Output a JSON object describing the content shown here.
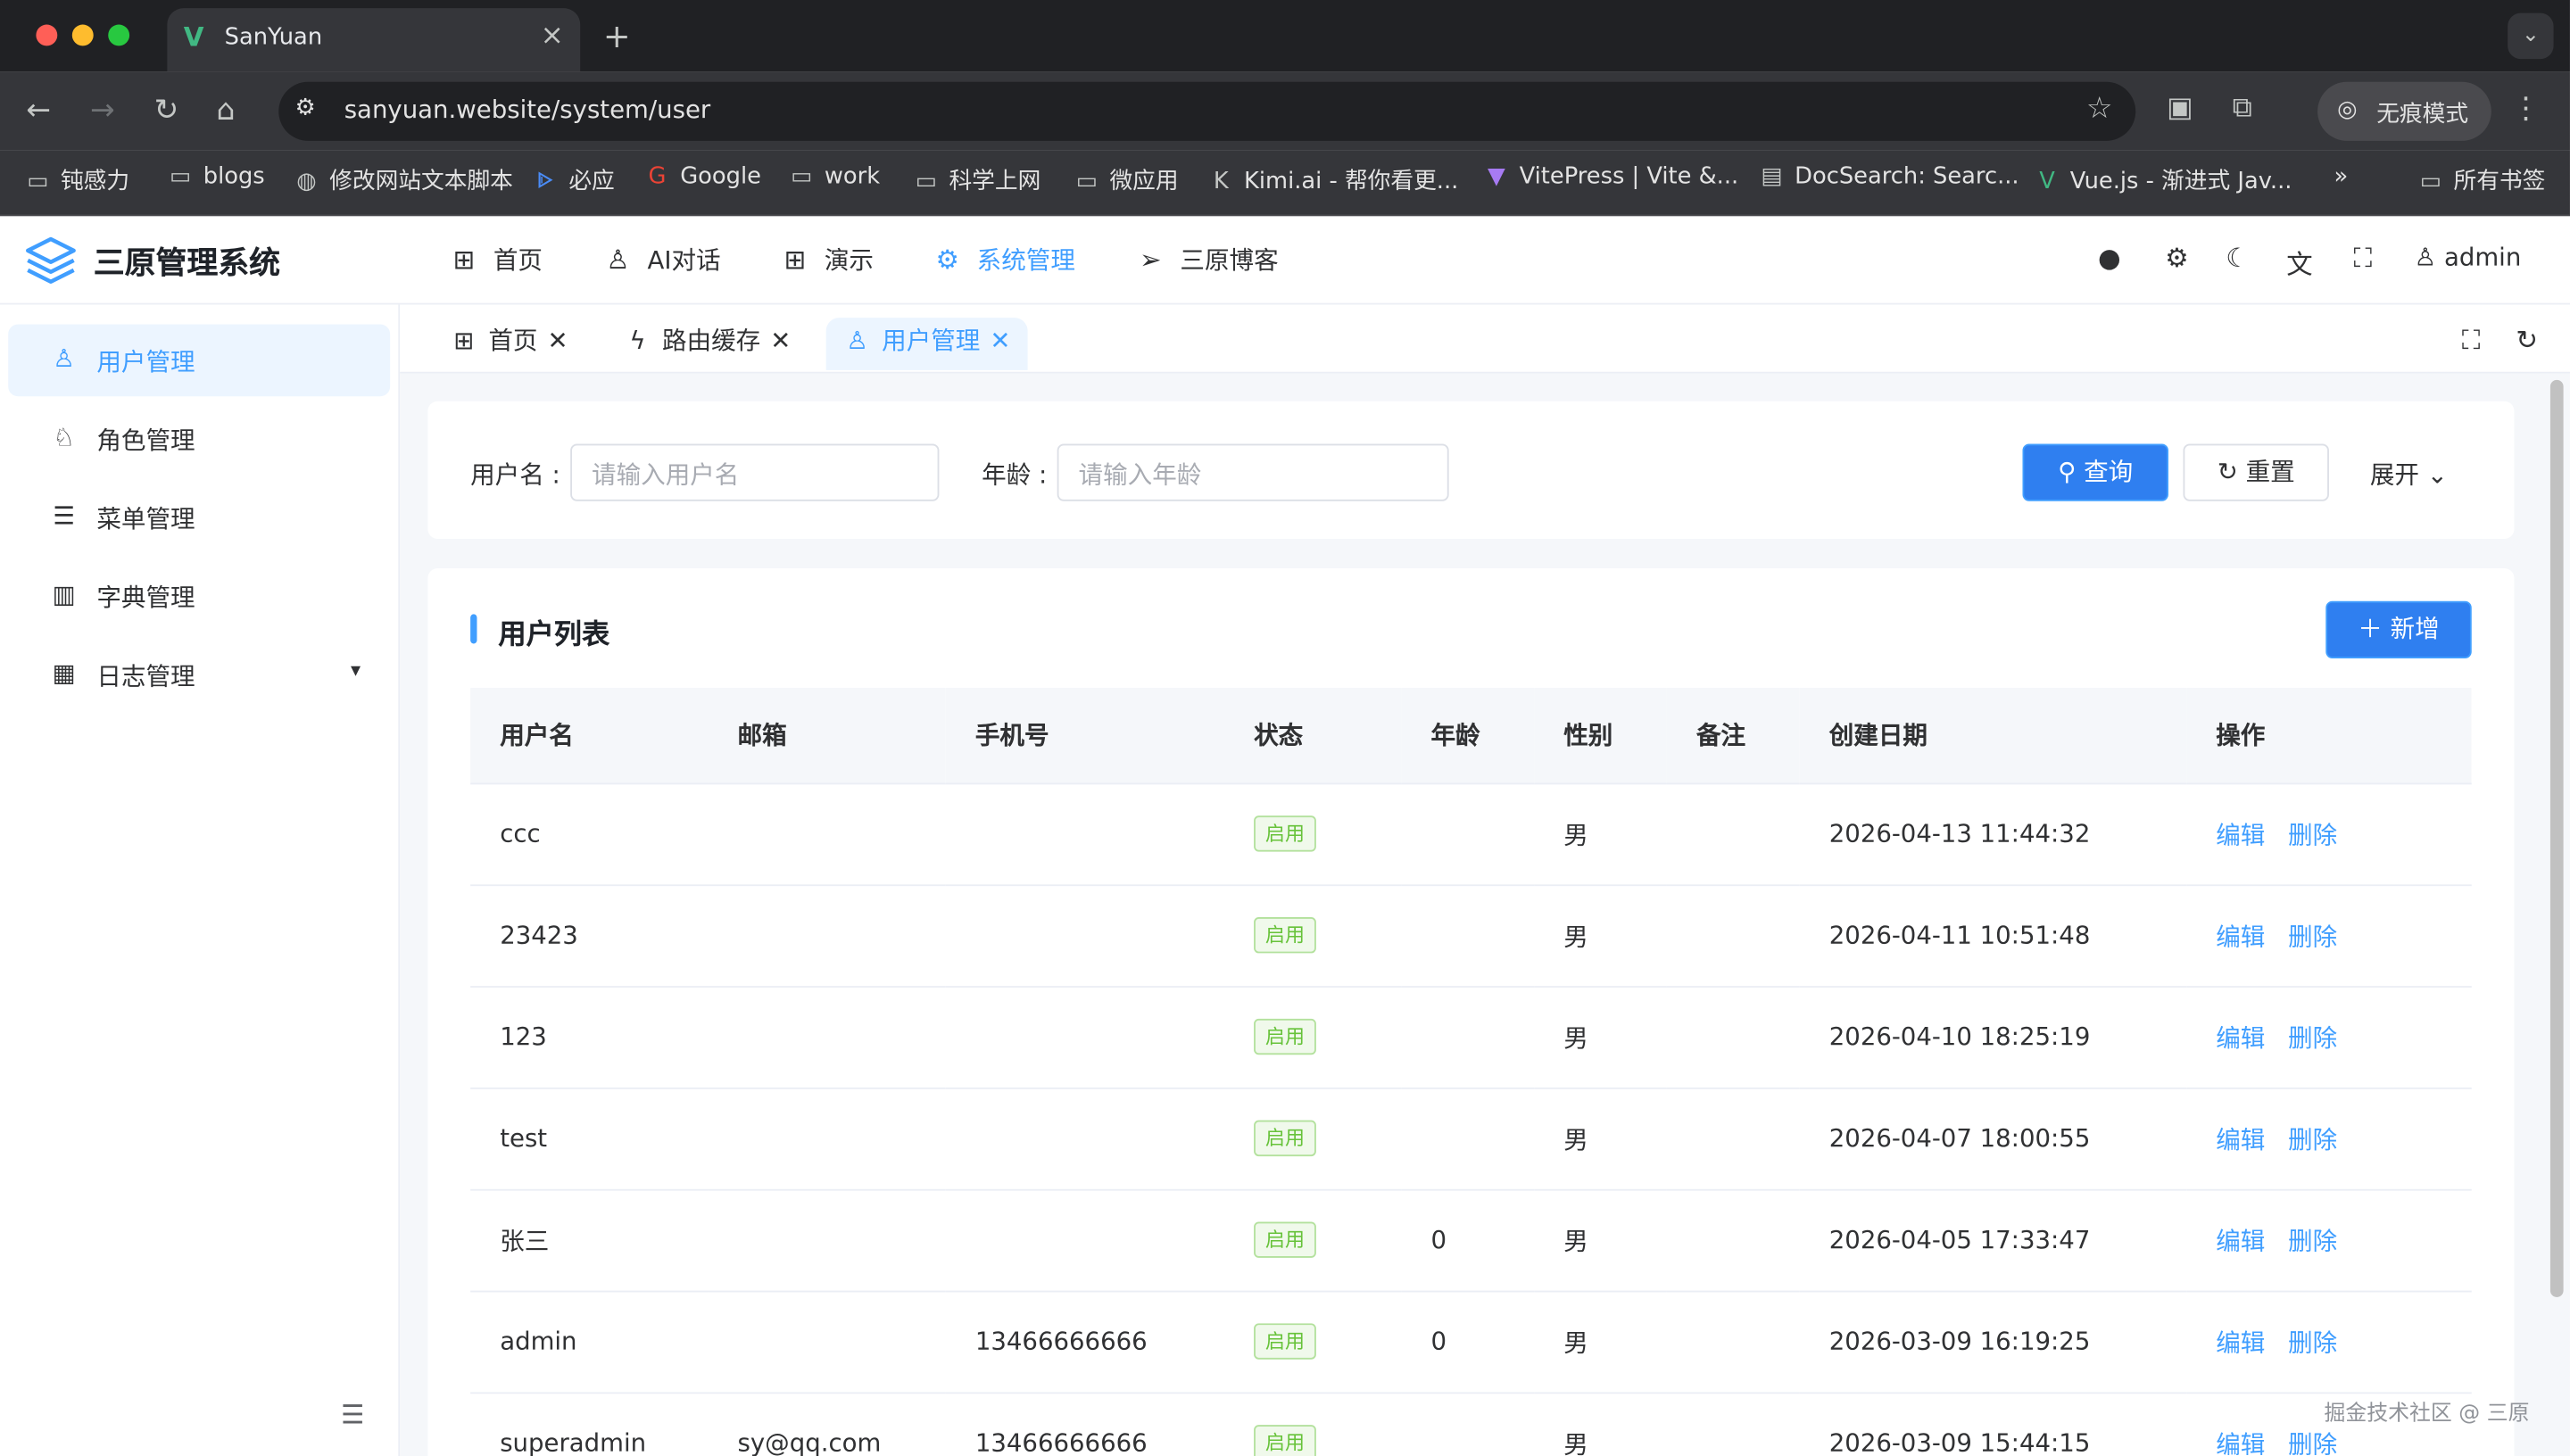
{
  "browser": {
    "tab_title": "SanYuan",
    "tab_favicon": "V",
    "url": "sanyuan.website/system/user",
    "incognito_label": "无痕模式",
    "bookmarks": [
      "钝感力",
      "blogs",
      "修改网站文本脚本",
      "必应",
      "Google",
      "work",
      "科学上网",
      "微应用",
      "Kimi.ai - 帮你看更...",
      "VitePress | Vite &...",
      "DocSearch: Searc...",
      "Vue.js - 渐进式 Jav..."
    ],
    "all_bookmarks": "所有书签",
    "more_bookmarks": "»"
  },
  "header": {
    "app_name": "三原管理系统",
    "nav": [
      "首页",
      "AI对话",
      "演示",
      "系统管理",
      "三原博客"
    ],
    "active_nav": "系统管理",
    "user": "admin"
  },
  "sidebar": {
    "items": [
      "用户管理",
      "角色管理",
      "菜单管理",
      "字典管理",
      "日志管理"
    ]
  },
  "tags": [
    "首页",
    "路由缓存",
    "用户管理"
  ],
  "search": {
    "username_label": "用户名 :",
    "username_placeholder": "请输入用户名",
    "age_label": "年龄 :",
    "age_placeholder": "请输入年龄",
    "query_button": "查询",
    "reset_button": "重置",
    "expand_label": "展开"
  },
  "list": {
    "title": "用户列表",
    "add_button": "新增",
    "columns": [
      "用户名",
      "邮箱",
      "手机号",
      "状态",
      "年龄",
      "性别",
      "备注",
      "创建日期",
      "操作"
    ],
    "edit_label": "编辑",
    "delete_label": "删除",
    "rows": [
      {
        "username": "ccc",
        "email": "",
        "phone": "",
        "status": "启用",
        "age": "",
        "gender": "男",
        "remark": "",
        "created": "2026-04-13 11:44:32"
      },
      {
        "username": "23423",
        "email": "",
        "phone": "",
        "status": "启用",
        "age": "",
        "gender": "男",
        "remark": "",
        "created": "2026-04-11 10:51:48"
      },
      {
        "username": "123",
        "email": "",
        "phone": "",
        "status": "启用",
        "age": "",
        "gender": "男",
        "remark": "",
        "created": "2026-04-10 18:25:19"
      },
      {
        "username": "test",
        "email": "",
        "phone": "",
        "status": "启用",
        "age": "",
        "gender": "男",
        "remark": "",
        "created": "2026-04-07 18:00:55"
      },
      {
        "username": "张三",
        "email": "",
        "phone": "",
        "status": "启用",
        "age": "0",
        "gender": "男",
        "remark": "",
        "created": "2026-04-05 17:33:47"
      },
      {
        "username": "admin",
        "email": "",
        "phone": "13466666666",
        "status": "启用",
        "age": "0",
        "gender": "男",
        "remark": "",
        "created": "2026-03-09 16:19:25"
      },
      {
        "username": "superadmin",
        "email": "sy@qq.com",
        "phone": "13466666666",
        "status": "启用",
        "age": "",
        "gender": "男",
        "remark": "",
        "created": "2026-03-09 15:44:15"
      }
    ]
  },
  "watermark": "掘金技术社区 @ 三原",
  "colors": {
    "primary": "#409eff",
    "success": "#67c23a"
  }
}
